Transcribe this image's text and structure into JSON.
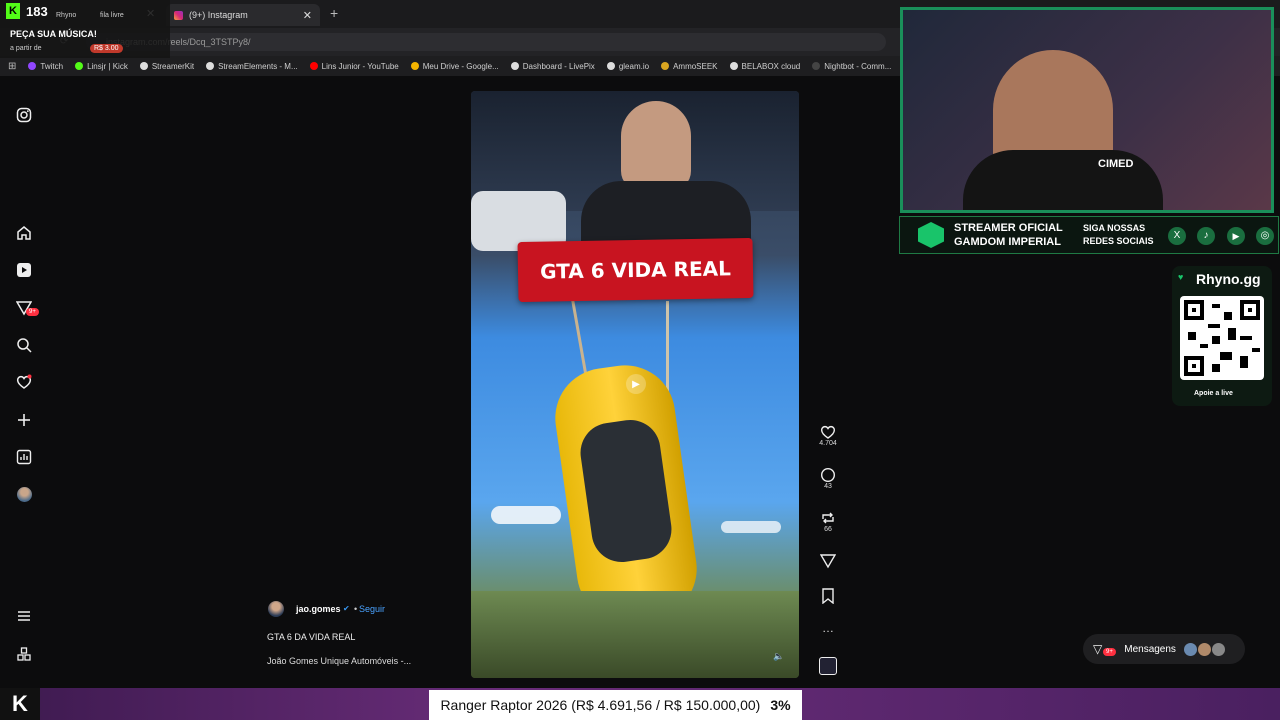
{
  "kick": {
    "count": "183",
    "user": "Rhyno",
    "msg_title": "PEÇA SUA MÚSICA!",
    "msg_sub": "a partir de",
    "price": "R$ 3.00",
    "tag": "fila livre"
  },
  "tabs": [
    {
      "label": "(9+) Instagram"
    }
  ],
  "address": {
    "url": "instagram.com/reels/Dcq_3TSTPy8/"
  },
  "bookmarks": [
    {
      "label": "Twitch",
      "color": "#9146ff"
    },
    {
      "label": "Linsjr | Kick",
      "color": "#53fc18"
    },
    {
      "label": "StreamerKit",
      "color": "#ddd"
    },
    {
      "label": "StreamElements - M...",
      "color": "#ddd"
    },
    {
      "label": "Lins Junior - YouTube",
      "color": "#ff0000"
    },
    {
      "label": "Meu Drive - Google...",
      "color": "#f4b400"
    },
    {
      "label": "Dashboard - LivePix",
      "color": "#ddd"
    },
    {
      "label": "gleam.io",
      "color": "#ddd"
    },
    {
      "label": "AmmoSEEK",
      "color": "#d9a520"
    },
    {
      "label": "BELABOX cloud",
      "color": "#ddd"
    },
    {
      "label": "Nightbot - Comm...",
      "color": "#444"
    }
  ],
  "reel": {
    "banner": "GTA 6 VIDA REAL",
    "author": "jao.gomes",
    "follow": "Seguir",
    "caption": "GTA 6 DA VIDA REAL",
    "audio": "João Gomes Unique Automóveis -..."
  },
  "actions": {
    "likes": "4.704",
    "comments": "43",
    "reposts": "66"
  },
  "side": {
    "badge": "9+"
  },
  "overlay": {
    "sponsor_title": "STREAMER OFICIAL",
    "sponsor_sub": "GAMDOM IMPERIAL",
    "social_title": "SIGA NOSSAS",
    "social_sub": "REDES SOCIAIS",
    "brand": "Rhyno.gg",
    "support": "Apoie a live",
    "cam_label": "CIMED"
  },
  "messages": {
    "label": "Mensagens",
    "badge": "9+"
  },
  "ticker": {
    "text": "Ranger Raptor 2026 (R$ 4.691,56 / R$ 150.000,00)",
    "percent": "3%"
  }
}
